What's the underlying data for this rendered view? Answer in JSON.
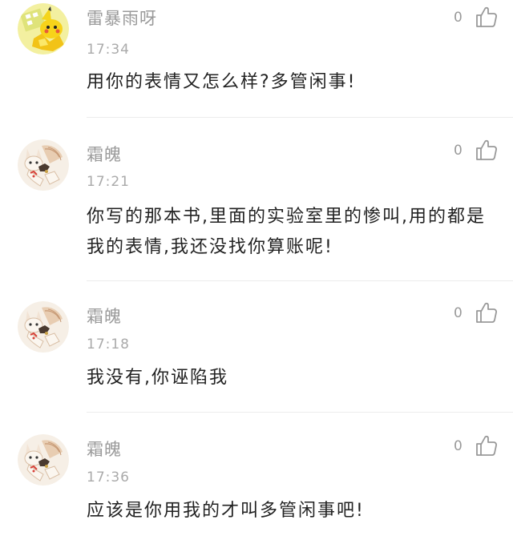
{
  "comments": [
    {
      "username": "雷暴雨呀",
      "time": "17:34",
      "likes": "0",
      "text": "用你的表情又怎么样?多管闲事!",
      "avatar": "pikachu-avatar"
    },
    {
      "username": "霜魄",
      "time": "17:21",
      "likes": "0",
      "text": "你写的那本书,里面的实验室里的惨叫,用的都是我的表情,我还没找你算账呢!",
      "avatar": "fox-avatar"
    },
    {
      "username": "霜魄",
      "time": "17:18",
      "likes": "0",
      "text": "我没有,你诬陷我",
      "avatar": "fox-avatar"
    },
    {
      "username": "霜魄",
      "time": "17:36",
      "likes": "0",
      "text": "应该是你用我的才叫多管闲事吧!",
      "avatar": "fox-avatar"
    }
  ],
  "colors": {
    "username": "#9a9a9a",
    "text": "#222222",
    "divider": "#ececec",
    "like_icon": "#999999"
  }
}
